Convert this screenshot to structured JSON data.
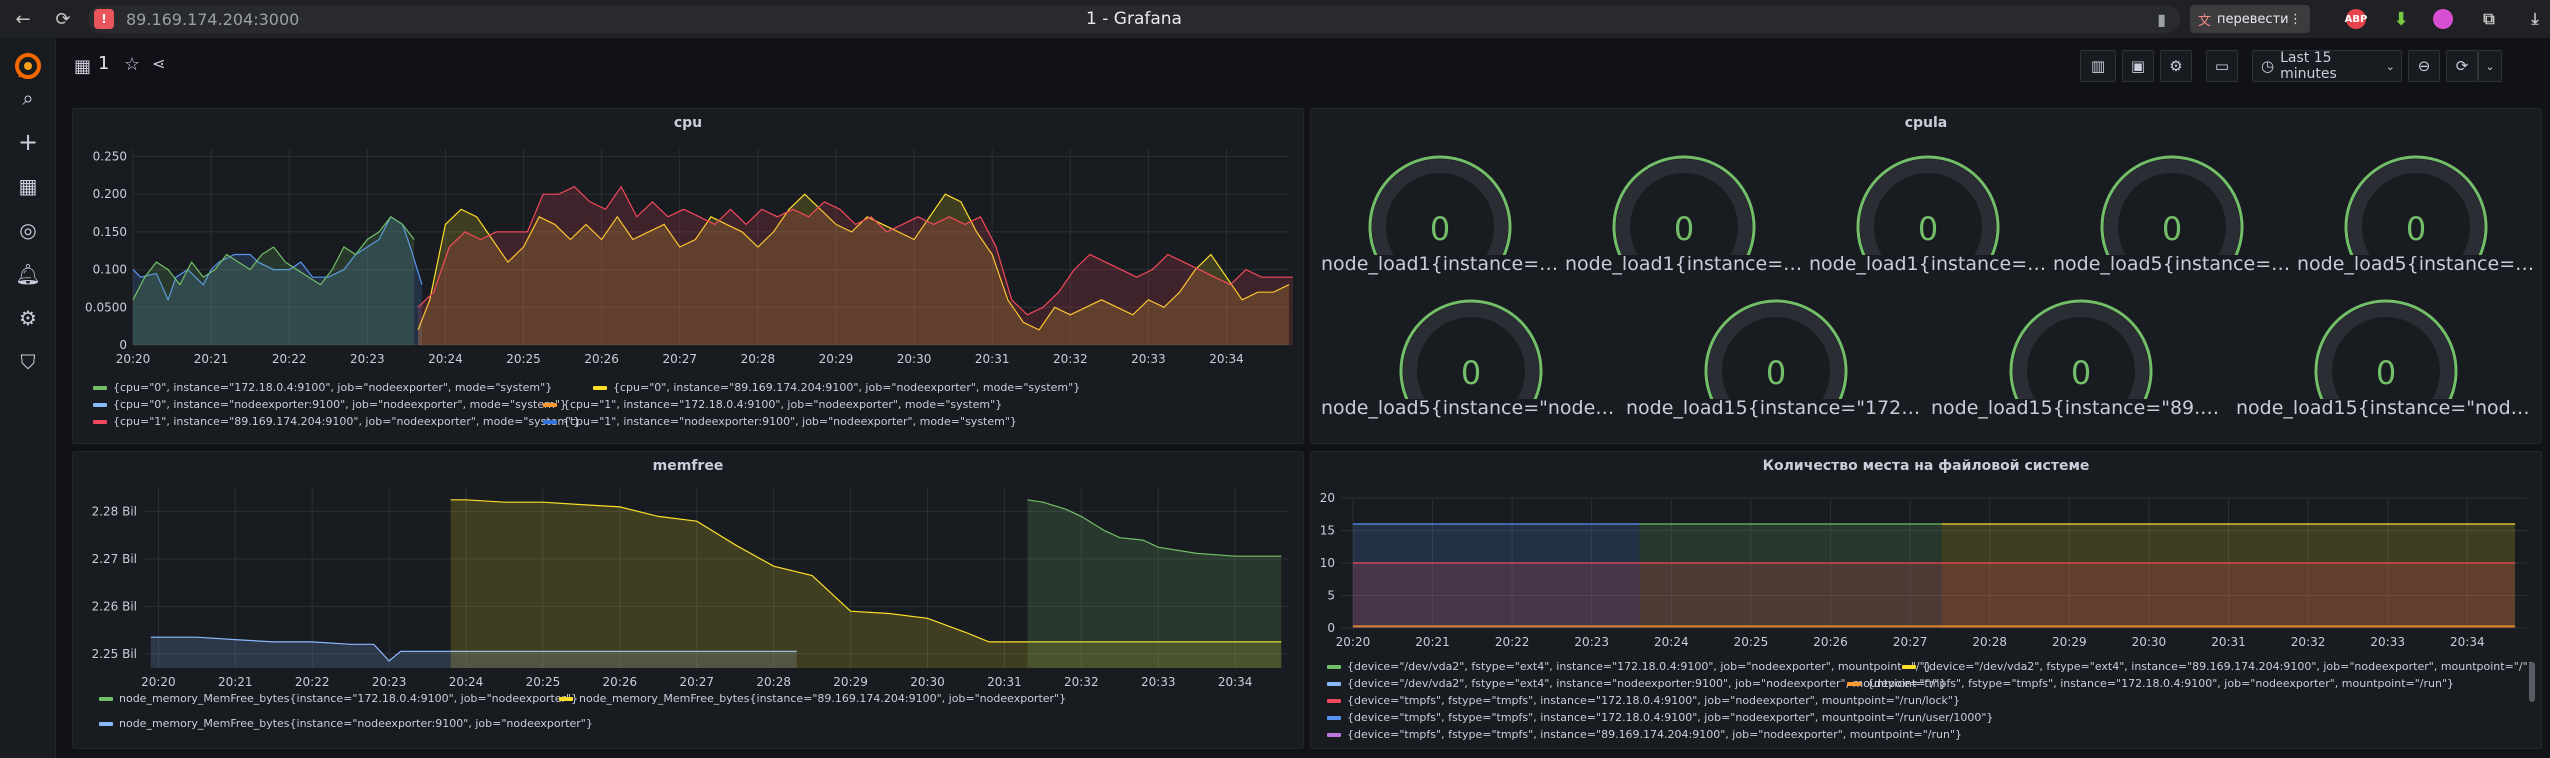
{
  "browser": {
    "url": "89.169.174.204:3000",
    "title": "1 - Grafana",
    "translate_label": "перевести",
    "abp_label": "ABP"
  },
  "dashboard": {
    "title": "1",
    "time_picker": "Last 15 minutes"
  },
  "colors": {
    "green": "#73bf69",
    "yellow": "#fade2a",
    "blue": "#5794f2",
    "orange": "#ff9830",
    "red": "#f2495c",
    "cyan": "#8ab8ff",
    "blue2": "#3274d9",
    "purple": "#b877d9"
  },
  "panels": {
    "cpu": {
      "title": "cpu",
      "legend": [
        "{cpu=\"0\", instance=\"172.18.0.4:9100\", job=\"nodeexporter\", mode=\"system\"}",
        "{cpu=\"0\", instance=\"89.169.174.204:9100\", job=\"nodeexporter\", mode=\"system\"}",
        "{cpu=\"0\", instance=\"nodeexporter:9100\", job=\"nodeexporter\", mode=\"system\"}",
        "{cpu=\"1\", instance=\"172.18.0.4:9100\", job=\"nodeexporter\", mode=\"system\"}",
        "{cpu=\"1\", instance=\"89.169.174.204:9100\", job=\"nodeexporter\", mode=\"system\"}",
        "{cpu=\"1\", instance=\"nodeexporter:9100\", job=\"nodeexporter\", mode=\"system\"}"
      ]
    },
    "cpula": {
      "title": "cpula",
      "gauges": [
        {
          "label": "node_load1{instance=\"1...",
          "value": "0"
        },
        {
          "label": "node_load1{instance=\"8...",
          "value": "0"
        },
        {
          "label": "node_load1{instance=\"n...",
          "value": "0"
        },
        {
          "label": "node_load5{instance=\"1...",
          "value": "0"
        },
        {
          "label": "node_load5{instance=\"8...",
          "value": "0"
        },
        {
          "label": "node_load5{instance=\"nodeexp...",
          "value": "0"
        },
        {
          "label": "node_load15{instance=\"172.18....",
          "value": "0"
        },
        {
          "label": "node_load15{instance=\"89.169....",
          "value": "0"
        },
        {
          "label": "node_load15{instance=\"nodeex...",
          "value": "0"
        }
      ]
    },
    "memfree": {
      "title": "memfree",
      "legend": [
        "node_memory_MemFree_bytes{instance=\"172.18.0.4:9100\", job=\"nodeexporter\"}",
        "node_memory_MemFree_bytes{instance=\"89.169.174.204:9100\", job=\"nodeexporter\"}",
        "node_memory_MemFree_bytes{instance=\"nodeexporter:9100\", job=\"nodeexporter\"}"
      ]
    },
    "disk": {
      "title": "Количество места на файловой системе",
      "legend": [
        "{device=\"/dev/vda2\", fstype=\"ext4\", instance=\"172.18.0.4:9100\", job=\"nodeexporter\", mountpoint=\"/\"}",
        "{device=\"/dev/vda2\", fstype=\"ext4\", instance=\"89.169.174.204:9100\", job=\"nodeexporter\", mountpoint=\"/\"}",
        "{device=\"/dev/vda2\", fstype=\"ext4\", instance=\"nodeexporter:9100\", job=\"nodeexporter\", mountpoint=\"/\"}",
        "{device=\"tmpfs\", fstype=\"tmpfs\", instance=\"172.18.0.4:9100\", job=\"nodeexporter\", mountpoint=\"/run\"}",
        "{device=\"tmpfs\", fstype=\"tmpfs\", instance=\"172.18.0.4:9100\", job=\"nodeexporter\", mountpoint=\"/run/lock\"}",
        "{device=\"tmpfs\", fstype=\"tmpfs\", instance=\"172.18.0.4:9100\", job=\"nodeexporter\", mountpoint=\"/run/user/1000\"}",
        "{device=\"tmpfs\", fstype=\"tmpfs\", instance=\"89.169.174.204:9100\", job=\"nodeexporter\", mountpoint=\"/run\"}"
      ]
    }
  },
  "chart_data": [
    {
      "type": "area",
      "title": "cpu",
      "x": [
        "20:20",
        "20:21",
        "20:22",
        "20:23",
        "20:24",
        "20:25",
        "20:26",
        "20:27",
        "20:28",
        "20:29",
        "20:30",
        "20:31",
        "20:32",
        "20:33",
        "20:34"
      ],
      "y_ticks": [
        "0",
        "0.0500",
        "0.100",
        "0.150",
        "0.200",
        "0.250"
      ],
      "ylim": [
        0,
        0.26
      ],
      "series": [
        {
          "color": "#5794f2",
          "x": [
            0,
            0.1,
            0.3,
            0.45,
            0.55,
            0.7,
            0.9,
            1.0,
            1.1,
            1.3,
            1.5,
            1.6,
            1.8,
            2.0,
            2.15,
            2.3,
            2.5,
            2.7,
            2.85,
            3.0,
            3.15,
            3.3,
            3.45,
            3.55,
            3.7
          ],
          "values": [
            0.1,
            0.09,
            0.095,
            0.06,
            0.09,
            0.1,
            0.08,
            0.1,
            0.11,
            0.12,
            0.12,
            0.11,
            0.1,
            0.1,
            0.11,
            0.09,
            0.09,
            0.1,
            0.12,
            0.13,
            0.14,
            0.17,
            0.16,
            0.13,
            0.08
          ]
        },
        {
          "color": "#73bf69",
          "x": [
            0,
            0.15,
            0.3,
            0.45,
            0.6,
            0.75,
            0.9,
            1.05,
            1.2,
            1.35,
            1.5,
            1.65,
            1.8,
            1.95,
            2.1,
            2.25,
            2.4,
            2.55,
            2.7,
            2.85,
            3.0,
            3.15,
            3.3,
            3.45,
            3.6
          ],
          "values": [
            0.06,
            0.09,
            0.11,
            0.1,
            0.08,
            0.11,
            0.09,
            0.1,
            0.12,
            0.11,
            0.1,
            0.12,
            0.13,
            0.11,
            0.1,
            0.09,
            0.08,
            0.1,
            0.13,
            0.12,
            0.14,
            0.15,
            0.17,
            0.16,
            0.14
          ]
        },
        {
          "color": "#fade2a",
          "x": [
            3.65,
            3.8,
            4.0,
            4.2,
            4.4,
            4.6,
            4.8,
            5.0,
            5.2,
            5.4,
            5.6,
            5.8,
            6.0,
            6.2,
            6.4,
            6.6,
            6.8,
            7.0,
            7.2,
            7.4,
            7.6,
            7.8,
            8.0,
            8.2,
            8.4,
            8.6,
            8.8,
            9.0,
            9.2,
            9.4,
            9.6,
            9.8,
            10.0,
            10.2,
            10.4,
            10.6,
            10.8,
            11.0,
            11.2,
            11.4,
            11.6,
            11.8,
            12.0,
            12.2,
            12.4,
            12.6,
            12.8,
            13.0,
            13.2,
            13.4,
            13.6,
            13.8,
            14.0,
            14.2,
            14.4,
            14.6,
            14.8
          ],
          "values": [
            0.02,
            0.06,
            0.16,
            0.18,
            0.17,
            0.14,
            0.11,
            0.13,
            0.17,
            0.16,
            0.14,
            0.16,
            0.14,
            0.17,
            0.14,
            0.15,
            0.16,
            0.13,
            0.14,
            0.17,
            0.16,
            0.15,
            0.13,
            0.15,
            0.18,
            0.2,
            0.18,
            0.16,
            0.15,
            0.17,
            0.16,
            0.15,
            0.14,
            0.17,
            0.2,
            0.19,
            0.15,
            0.12,
            0.06,
            0.03,
            0.02,
            0.05,
            0.04,
            0.05,
            0.06,
            0.05,
            0.04,
            0.06,
            0.05,
            0.07,
            0.1,
            0.12,
            0.09,
            0.06,
            0.07,
            0.07,
            0.08
          ]
        },
        {
          "color": "#f2495c",
          "x": [
            3.65,
            3.85,
            4.05,
            4.25,
            4.45,
            4.65,
            4.85,
            5.05,
            5.25,
            5.45,
            5.65,
            5.85,
            6.05,
            6.25,
            6.45,
            6.65,
            6.85,
            7.05,
            7.25,
            7.45,
            7.65,
            7.85,
            8.05,
            8.25,
            8.45,
            8.65,
            8.85,
            9.05,
            9.25,
            9.45,
            9.65,
            9.85,
            10.05,
            10.25,
            10.45,
            10.65,
            10.85,
            11.05,
            11.25,
            11.45,
            11.65,
            11.85,
            12.05,
            12.25,
            12.45,
            12.65,
            12.85,
            13.05,
            13.25,
            13.45,
            13.65,
            13.85,
            14.05,
            14.25,
            14.45,
            14.65,
            14.85
          ],
          "values": [
            0.05,
            0.07,
            0.13,
            0.15,
            0.14,
            0.15,
            0.15,
            0.15,
            0.2,
            0.2,
            0.21,
            0.19,
            0.18,
            0.21,
            0.17,
            0.19,
            0.17,
            0.18,
            0.17,
            0.16,
            0.18,
            0.16,
            0.18,
            0.17,
            0.18,
            0.17,
            0.19,
            0.18,
            0.16,
            0.17,
            0.15,
            0.16,
            0.17,
            0.16,
            0.17,
            0.16,
            0.17,
            0.13,
            0.06,
            0.04,
            0.05,
            0.07,
            0.1,
            0.12,
            0.11,
            0.1,
            0.09,
            0.1,
            0.12,
            0.11,
            0.1,
            0.09,
            0.08,
            0.1,
            0.09,
            0.09,
            0.09
          ]
        }
      ]
    },
    {
      "type": "gauge",
      "title": "cpula",
      "values": [
        0,
        0,
        0,
        0,
        0,
        0,
        0,
        0,
        0
      ]
    },
    {
      "type": "area",
      "title": "memfree",
      "x": [
        "20:20",
        "20:21",
        "20:22",
        "20:23",
        "20:24",
        "20:25",
        "20:26",
        "20:27",
        "20:28",
        "20:29",
        "20:30",
        "20:31",
        "20:32",
        "20:33",
        "20:34"
      ],
      "y_ticks": [
        "2.25 Bil",
        "2.26 Bil",
        "2.27 Bil",
        "2.28 Bil"
      ],
      "ylim": [
        2.247,
        2.285
      ],
      "series": [
        {
          "color": "#8ab8ff",
          "x": [
            -0.1,
            0.5,
            1.0,
            1.5,
            2.0,
            2.5,
            2.8,
            3.0,
            3.15,
            3.3,
            3.6,
            4.0,
            4.5,
            5.0,
            5.5,
            6.0,
            6.5,
            7.0,
            7.5,
            8.0,
            8.3
          ],
          "values": [
            2.2535,
            2.2535,
            2.253,
            2.2525,
            2.2525,
            2.252,
            2.252,
            2.2485,
            2.2505,
            2.2505,
            2.2505,
            2.2505,
            2.2505,
            2.2505,
            2.2505,
            2.2505,
            2.2505,
            2.2505,
            2.2505,
            2.2505,
            2.2505
          ]
        },
        {
          "color": "#fade2a",
          "x": [
            3.8,
            4.0,
            4.5,
            5.0,
            5.5,
            6.0,
            6.5,
            7.0,
            7.5,
            8.0,
            8.5,
            9.0,
            9.5,
            10.0,
            10.5,
            10.8,
            11.0,
            11.5,
            12.0,
            12.5,
            13.0,
            13.5,
            14.0,
            14.6
          ],
          "values": [
            2.2825,
            2.2825,
            2.282,
            2.282,
            2.2815,
            2.281,
            2.279,
            2.278,
            2.273,
            2.2685,
            2.2665,
            2.259,
            2.2585,
            2.2575,
            2.2545,
            2.2525,
            2.2525,
            2.2525,
            2.2525,
            2.2525,
            2.2525,
            2.2525,
            2.2525,
            2.2525
          ]
        },
        {
          "color": "#73bf69",
          "x": [
            11.3,
            11.5,
            11.8,
            12.0,
            12.3,
            12.5,
            12.8,
            13.0,
            13.5,
            14.0,
            14.6
          ],
          "values": [
            2.2825,
            2.282,
            2.2805,
            2.279,
            2.276,
            2.2745,
            2.274,
            2.2725,
            2.2712,
            2.2706,
            2.2706
          ]
        }
      ]
    },
    {
      "type": "area",
      "title": "Количество места на файловой системе",
      "x": [
        "20:20",
        "20:21",
        "20:22",
        "20:23",
        "20:24",
        "20:25",
        "20:26",
        "20:27",
        "20:28",
        "20:29",
        "20:30",
        "20:31",
        "20:32",
        "20:33",
        "20:34"
      ],
      "y_ticks": [
        "0",
        "5",
        "10",
        "15",
        "20"
      ],
      "ylim": [
        0,
        20
      ],
      "series": [
        {
          "color": "#5794f2",
          "range": [
            0,
            3.6
          ],
          "values": [
            16,
            16
          ]
        },
        {
          "color": "#73bf69",
          "range": [
            3.6,
            7.4
          ],
          "values": [
            16,
            16
          ]
        },
        {
          "color": "#fade2a",
          "range": [
            7.4,
            14.6
          ],
          "values": [
            16,
            16
          ]
        },
        {
          "color": "#f2495c",
          "range": [
            0,
            14.6
          ],
          "values": [
            10,
            10
          ]
        },
        {
          "color": "#ff9830",
          "range": [
            0,
            14.6
          ],
          "values": [
            0.3,
            0.3
          ]
        }
      ]
    }
  ]
}
